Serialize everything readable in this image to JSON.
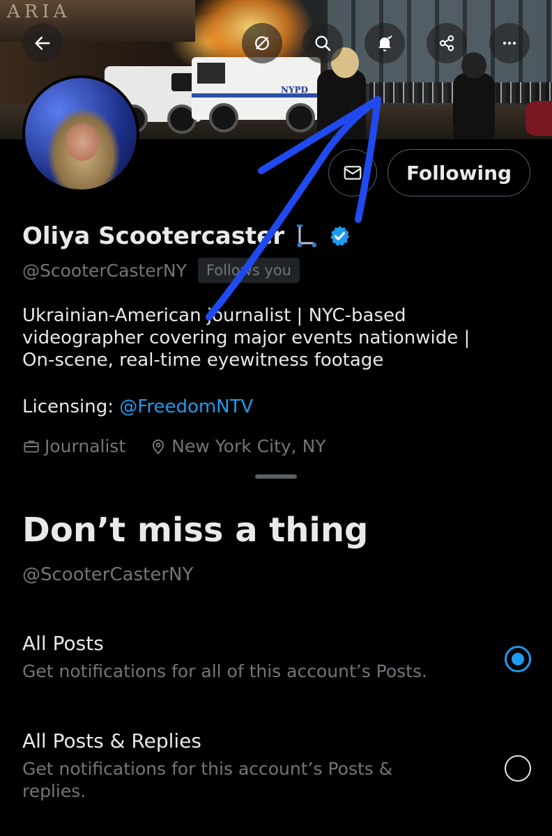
{
  "banner": {
    "sign_text": "ARIA",
    "vehicle_text": "NYPD"
  },
  "profile": {
    "display_name": "Oliya Scootercaster",
    "handle": "@ScooterCasterNY",
    "follows_you": "Follows you",
    "following_button": "Following",
    "bio_lines": [
      "Ukrainian-American journalist | NYC-based",
      "videographer covering major events nationwide |",
      "On-scene, real-time eyewitness footage"
    ],
    "licensing_label": "Licensing:",
    "licensing_link": "@FreedomNTV",
    "category": "Journalist",
    "location": "New York City, NY"
  },
  "sheet": {
    "title": "Don’t miss a thing",
    "subtitle": "@ScooterCasterNY",
    "options": [
      {
        "title": "All Posts",
        "description": "Get notifications for all of this account’s Posts.",
        "selected": true
      },
      {
        "title": "All Posts & Replies",
        "description": "Get notifications for this account’s Posts & replies.",
        "selected": false
      }
    ]
  },
  "icons": {
    "top_bar": [
      "back-arrow-icon",
      "block-icon",
      "search-icon",
      "bell-check-icon",
      "share-icon",
      "more-icon"
    ],
    "message": "envelope-icon",
    "scooter": "kick-scooter-icon",
    "verified": "verified-badge-icon",
    "category": "briefcase-icon",
    "location": "location-pin-icon"
  },
  "colors": {
    "background": "#000000",
    "primary_text": "#e7e9ea",
    "secondary_text": "#71767b",
    "accent": "#1d9bf0",
    "annotation": "#1f4af0"
  }
}
